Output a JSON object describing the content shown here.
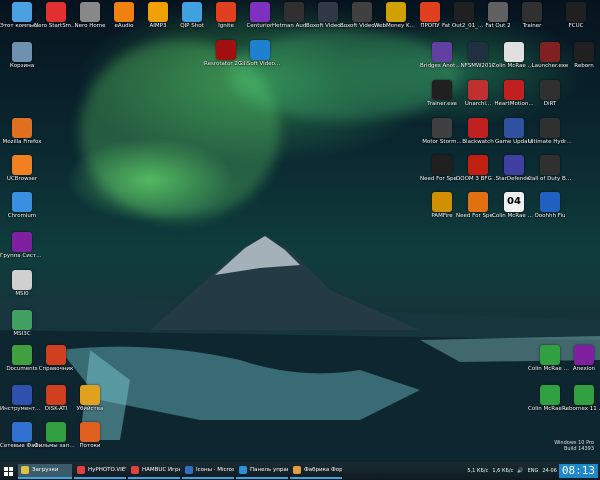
{
  "desktop": {
    "icons": [
      {
        "label": "Этот компьютер",
        "color": "#4aa0e0"
      },
      {
        "label": "Nero StartSmart",
        "color": "#e03030"
      },
      {
        "label": "Nero Home",
        "color": "#888888"
      },
      {
        "label": "eAudio",
        "color": "#f08010"
      },
      {
        "label": "AIMP3",
        "color": "#f0a000"
      },
      {
        "label": "QIP Shot",
        "color": "#40a0e0"
      },
      {
        "label": "Ignite",
        "color": "#e04020"
      },
      {
        "label": "Centurion",
        "color": "#8030c0"
      },
      {
        "label": "Hetman Audio Reco...",
        "color": "#303030"
      },
      {
        "label": "Boxoft Video Split...",
        "color": "#303848"
      },
      {
        "label": "Boxoft Video to G...",
        "color": "#404040"
      },
      {
        "label": "WebMoney Keeper W...",
        "color": "#d0a000"
      },
      {
        "label": "ПРОПУ",
        "color": "#e04020"
      },
      {
        "label": "Fat Out2_01_Si...",
        "color": "#202020"
      },
      {
        "label": "Fat Out 2",
        "color": "#606060"
      },
      {
        "label": "Trainer",
        "color": "#303030"
      },
      {
        "label": "FCUC",
        "color": "#202020"
      },
      {
        "label": "Корзина",
        "color": "#7090b0"
      },
      {
        "label": "Resrotator 2007",
        "color": "#a01010"
      },
      {
        "label": "GiliSoft Video Editor 7.2.0",
        "color": "#2080d0"
      },
      {
        "label": "Bridges Another...",
        "color": "#6040a0"
      },
      {
        "label": "NFSMW2012",
        "color": "#203040"
      },
      {
        "label": "Colin McRae Rally 2005",
        "color": "#e0e0e0"
      },
      {
        "label": "Launcher.exe",
        "color": "#802020"
      },
      {
        "label": "Reborn",
        "color": "#202020"
      },
      {
        "label": "Mozilla Firefox",
        "color": "#e07020"
      },
      {
        "label": "Trainer.exe",
        "color": "#202020"
      },
      {
        "label": "Unarchi...",
        "color": "#c03030"
      },
      {
        "label": "HeartMotion...",
        "color": "#c02020"
      },
      {
        "label": "DiRT",
        "color": "#303030"
      },
      {
        "label": "UCBrowser",
        "color": "#f08020"
      },
      {
        "label": "Motor Storm...",
        "color": "#404040"
      },
      {
        "label": "Blackwatch",
        "color": "#c02020"
      },
      {
        "label": "Game Update",
        "color": "#3050a0"
      },
      {
        "label": "Ultimate Hydro...",
        "color": "#303030"
      },
      {
        "label": "Chromium",
        "color": "#3a90e0"
      },
      {
        "label": "Need For Speed T...",
        "color": "#202020"
      },
      {
        "label": "DOOM 3 BFG Edition",
        "color": "#c02010"
      },
      {
        "label": "StarDefender",
        "color": "#4040a0"
      },
      {
        "label": "Call of Duty Black Op...",
        "color": "#303030"
      },
      {
        "label": "Группа Системы",
        "color": "#8020a0"
      },
      {
        "label": "PAMFire",
        "color": "#d09000"
      },
      {
        "label": "Need For Speed - Mo...",
        "color": "#e07010"
      },
      {
        "label": "Colin McRae Rally 04",
        "color": "#f0f0f0",
        "text": "04"
      },
      {
        "label": "Ooohhh Fiu",
        "color": "#2060c0"
      },
      {
        "label": "MSI0",
        "color": "#d0d0d0"
      },
      {
        "label": "MSI3C",
        "color": "#40a060"
      },
      {
        "label": "Documents",
        "color": "#40a040"
      },
      {
        "label": "Справочник",
        "color": "#d04020"
      },
      {
        "label": "Colin McRae Rally 04 Bec...",
        "color": "#30a040"
      },
      {
        "label": "Anexion",
        "color": "#8020a0"
      },
      {
        "label": "Инструменты...",
        "color": "#3050b0"
      },
      {
        "label": "DISK-ATI",
        "color": "#d04020"
      },
      {
        "label": "Убийства",
        "color": "#e0a020"
      },
      {
        "label": "Colin McRae Rally 4.bit",
        "color": "#30a040"
      },
      {
        "label": "Rebornex 11 Trainer",
        "color": "#30a040"
      },
      {
        "label": "Сетевые Файлы",
        "color": "#3070d0"
      },
      {
        "label": "Фильмы записи",
        "color": "#30a040"
      },
      {
        "label": "Потоки",
        "color": "#e06020"
      }
    ]
  },
  "watermark": {
    "line1": "Windows 10 Pro",
    "line2": "Build 14393"
  },
  "taskbar": {
    "tasks": [
      {
        "label": "Загрузки",
        "color": "#e0c040"
      },
      {
        "label": "HyPHOTO.VIEW",
        "color": "#e04040"
      },
      {
        "label": "HAMBUC Игры...",
        "color": "#e04040"
      },
      {
        "label": "Ісоны · Micros...",
        "color": "#3070c0"
      },
      {
        "label": "Панель управл...",
        "color": "#3090d0"
      },
      {
        "label": "Фабрика Фор...",
        "color": "#e0a040"
      }
    ],
    "tray": {
      "net": "5,1 КБ/с",
      "net2": "1,6 КБ/с",
      "lang": "ENG",
      "date": "24-06",
      "clock": "08:13"
    }
  }
}
